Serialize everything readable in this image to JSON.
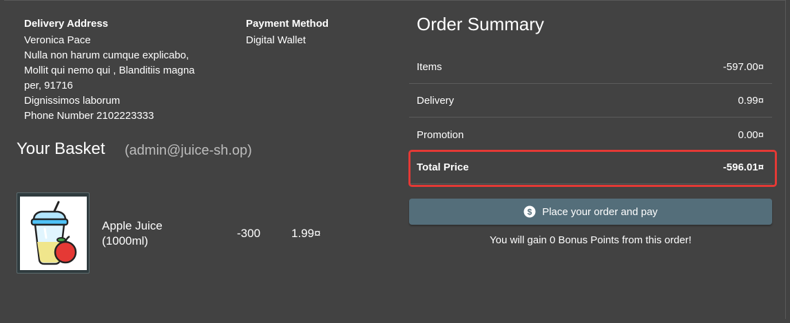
{
  "delivery": {
    "title": "Delivery Address",
    "name": "Veronica Pace",
    "line1": "Nulla non harum cumque explicabo,",
    "line2": "Mollit qui nemo qui , Blanditiis magna",
    "line3": "per, 91716",
    "line4": "Dignissimos laborum",
    "phone": "Phone Number 2102223333"
  },
  "payment": {
    "title": "Payment Method",
    "method": "Digital Wallet"
  },
  "basket": {
    "title": "Your Basket",
    "user": "(admin@juice-sh.op)",
    "items": [
      {
        "name": "Apple Juice (1000ml)",
        "quantity": "-300",
        "price": "1.99¤"
      }
    ]
  },
  "summary": {
    "title": "Order Summary",
    "items_label": "Items",
    "items_value": "-597.00¤",
    "delivery_label": "Delivery",
    "delivery_value": "0.99¤",
    "promotion_label": "Promotion",
    "promotion_value": "0.00¤",
    "total_label": "Total Price",
    "total_value": "-596.01¤",
    "pay_button": "Place your order and pay",
    "bonus_text": "You will gain 0 Bonus Points from this order!"
  },
  "colors": {
    "background": "#424242",
    "button": "#546e7a",
    "highlight": "#e53935"
  },
  "icons": {
    "pay_button_icon": "dollar-circle-icon",
    "product_image": "apple-juice-icon"
  }
}
